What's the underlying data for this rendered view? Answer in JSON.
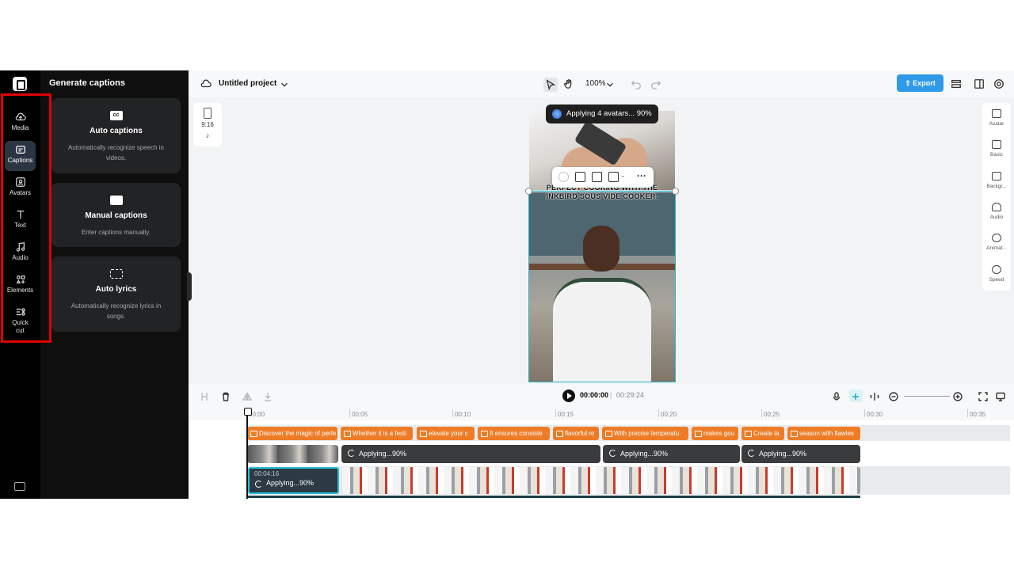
{
  "rail": {
    "items": [
      {
        "label": "Media",
        "icon": "cloud-upload-icon"
      },
      {
        "label": "Captions",
        "icon": "captions-icon",
        "active": true
      },
      {
        "label": "Avatars",
        "icon": "avatar-icon"
      },
      {
        "label": "Text",
        "icon": "text-icon"
      },
      {
        "label": "Audio",
        "icon": "music-note-icon"
      },
      {
        "label": "Elements",
        "icon": "elements-icon"
      },
      {
        "label": "Quick cut",
        "icon": "quick-cut-icon"
      }
    ]
  },
  "panel": {
    "title": "Generate captions",
    "cards": [
      {
        "title": "Auto captions",
        "description": "Automatically recognize speech in videos.",
        "icon": "cc-icon"
      },
      {
        "title": "Manual captions",
        "description": "Enter captions manually.",
        "icon": "keyboard-icon"
      },
      {
        "title": "Auto lyrics",
        "description": "Automatically recognize lyrics in songs.",
        "icon": "lyrics-scan-icon"
      }
    ]
  },
  "topbar": {
    "project_name": "Untitled project",
    "zoom": "100%",
    "export_label": "Export"
  },
  "canvas": {
    "ratio_label": "9:16",
    "toast": "Applying 4 avatars... 90%",
    "video_caption": "PERFECT COOKING WITH THE INKBIRD SOUS VIDE COOKER."
  },
  "right_panel": {
    "items": [
      "Avatar",
      "Basic",
      "Backgr...",
      "Audio",
      "Animat...",
      "Speed"
    ]
  },
  "timeline": {
    "current_time": "00:00:00",
    "total_time": "00:29:24",
    "ticks": [
      "00:00",
      "00:05",
      "00:10",
      "00:15",
      "00:20",
      "00:25",
      "00:30",
      "00:35"
    ],
    "caption_clips": [
      "Discover the magic of perfe",
      "Whether it is a festi",
      "elevate your c",
      "It ensures consiste",
      "flavorful re",
      "With precise temperatu",
      "makes gou",
      "Create la",
      "season with flawles"
    ],
    "avatar_clips": [
      "Applying...90%",
      "Applying...90%",
      "Applying...90%"
    ],
    "main_clip": {
      "time": "00:04:16",
      "status": "Applying...90%"
    }
  },
  "colors": {
    "accent": "#2f9be8",
    "caption_clip": "#ee7c27",
    "selection": "#22c3d6",
    "highlight": "#e00000"
  }
}
